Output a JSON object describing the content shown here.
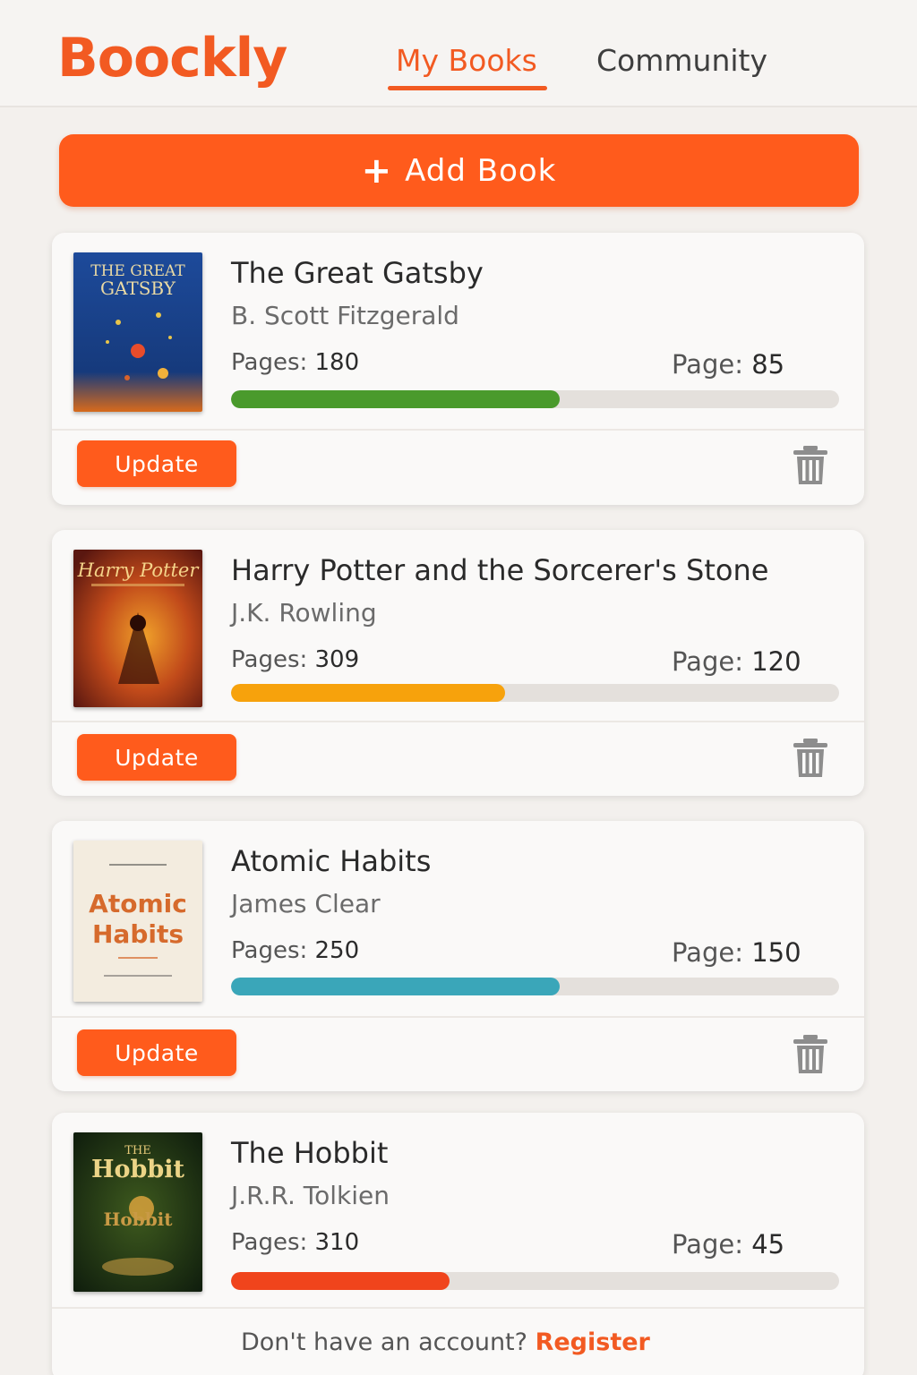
{
  "app": {
    "logo": "Boockly"
  },
  "nav": {
    "tabs": [
      {
        "label": "My Books",
        "active": true
      },
      {
        "label": "Community",
        "active": false
      }
    ]
  },
  "actions": {
    "add_book_label": "Add Book",
    "add_book_icon": "plus-icon"
  },
  "labels": {
    "pages_prefix": "Pages:",
    "page_prefix": "Page:",
    "update_label": "Update"
  },
  "books": [
    {
      "title": "The Great Gatsby",
      "author": "B. Scott Fitzgerald",
      "pages": "180",
      "current_page": "85",
      "progress": 0.54,
      "bar_color": "#4a9a2c",
      "cover": {
        "top": "THE GREAT",
        "main": "GATSBY",
        "colors": [
          "#1c3f86",
          "#0f2a62"
        ]
      }
    },
    {
      "title": "Harry Potter and the Sorcerer's Stone",
      "author": "J.K. Rowling",
      "pages": "309",
      "current_page": "120",
      "progress": 0.45,
      "bar_color": "#f7a20c",
      "cover": {
        "main": "Harry Potter",
        "colors": [
          "#b5331a",
          "#5a1710"
        ]
      }
    },
    {
      "title": "Atomic Habits",
      "author": "James Clear",
      "pages": "250",
      "current_page": "150",
      "progress": 0.54,
      "bar_color": "#3aa6b9",
      "cover": {
        "main": "Atomic Habits",
        "colors": [
          "#f4ede0",
          "#efe5d3"
        ]
      }
    },
    {
      "title": "The Hobbit",
      "author": "J.R.R. Tolkien",
      "pages": "310",
      "current_page": "45",
      "progress": 0.36,
      "bar_color": "#f0441c",
      "cover": {
        "top": "THE",
        "main": "Hobbit",
        "colors": [
          "#20361a",
          "#0f1d0d"
        ]
      }
    }
  ],
  "footer": {
    "prompt": "Don't have an account?",
    "link": "Register"
  }
}
